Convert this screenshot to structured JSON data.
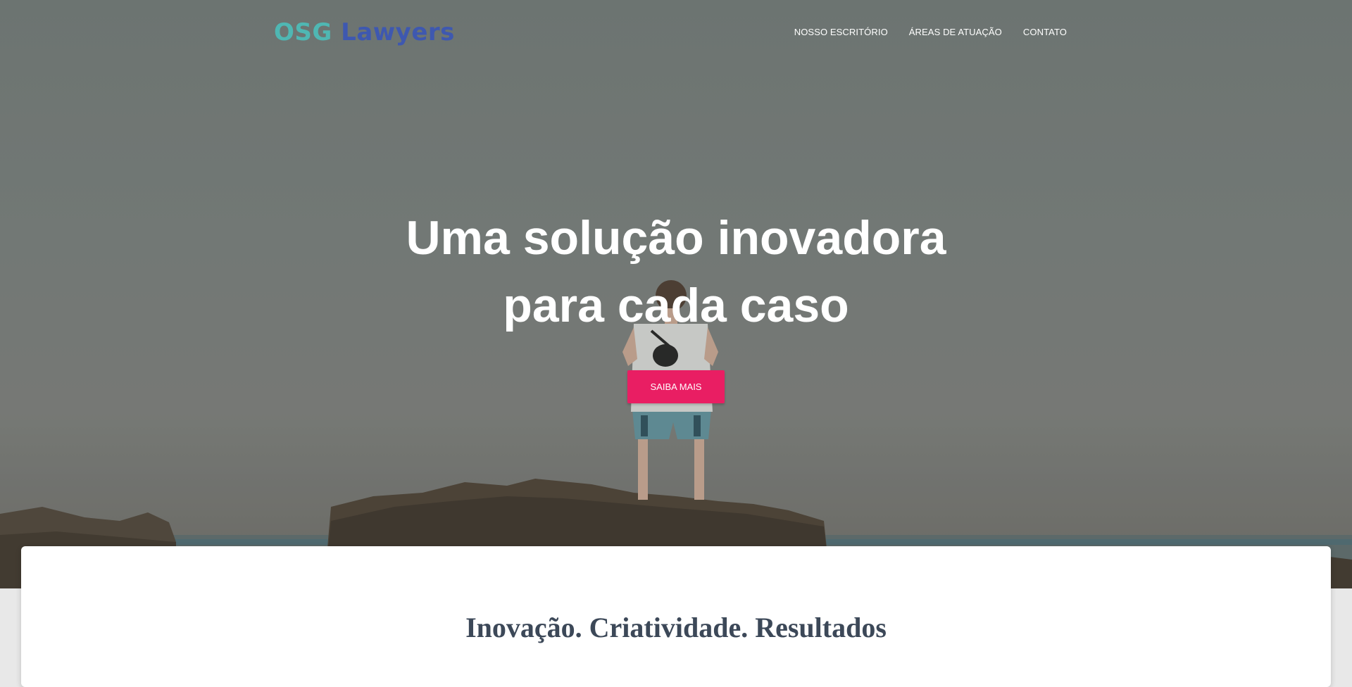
{
  "header": {
    "logo": {
      "part1": "OSG",
      "part2": "Lawyers"
    },
    "nav": [
      {
        "label": "NOSSO ESCRITÓRIO"
      },
      {
        "label": "ÁREAS DE ATUAÇÃO"
      },
      {
        "label": "CONTATO"
      }
    ]
  },
  "hero": {
    "title_line1": "Uma solução inovadora",
    "title_line2": "para cada caso",
    "cta_label": "SAIBA MAIS"
  },
  "section": {
    "title": "Inovação. Criatividade. Resultados"
  },
  "colors": {
    "accent": "#e91e63",
    "logo_teal": "#4fb7b3",
    "logo_blue": "#3e58b0",
    "heading": "#3c4858"
  },
  "icons": []
}
